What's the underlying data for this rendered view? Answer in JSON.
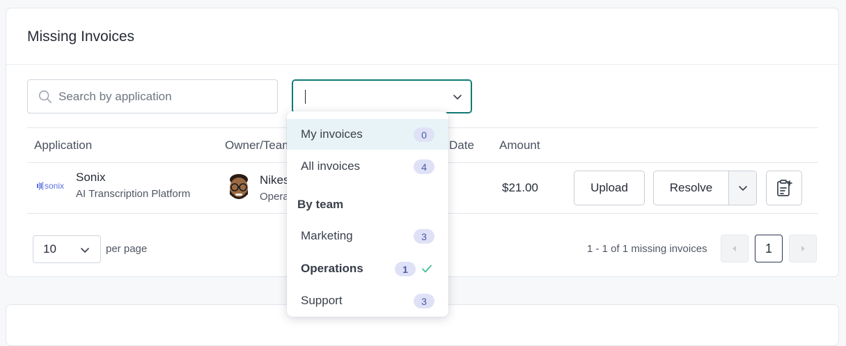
{
  "card": {
    "title": "Missing Invoices"
  },
  "search": {
    "placeholder": "Search by application"
  },
  "filter": {
    "value": ""
  },
  "table": {
    "headers": {
      "application": "Application",
      "owner": "Owner/Team",
      "date": "Date",
      "amount": "Amount"
    },
    "rows": [
      {
        "app_logo": "sonix",
        "app_name": "Sonix",
        "app_desc": "AI Transcription Platform",
        "owner_name": "Nikes",
        "owner_team": "Operat",
        "amount": "$21.00",
        "upload_label": "Upload",
        "resolve_label": "Resolve"
      }
    ]
  },
  "pagination": {
    "per_page": "10",
    "per_page_label": "per page",
    "range": "1 - 1 of 1 missing invoices",
    "current": "1"
  },
  "menu": {
    "items": [
      {
        "label": "My invoices",
        "count": "0"
      },
      {
        "label": "All invoices",
        "count": "4"
      }
    ],
    "group_label": "By team",
    "teams": [
      {
        "label": "Marketing",
        "count": "3"
      },
      {
        "label": "Operations",
        "count": "1",
        "selected": true
      },
      {
        "label": "Support",
        "count": "3"
      }
    ]
  },
  "colors": {
    "accent": "#0e7a74",
    "badge_bg": "#dfe2f6",
    "badge_text": "#4c58a8",
    "check": "#3ec28f"
  }
}
